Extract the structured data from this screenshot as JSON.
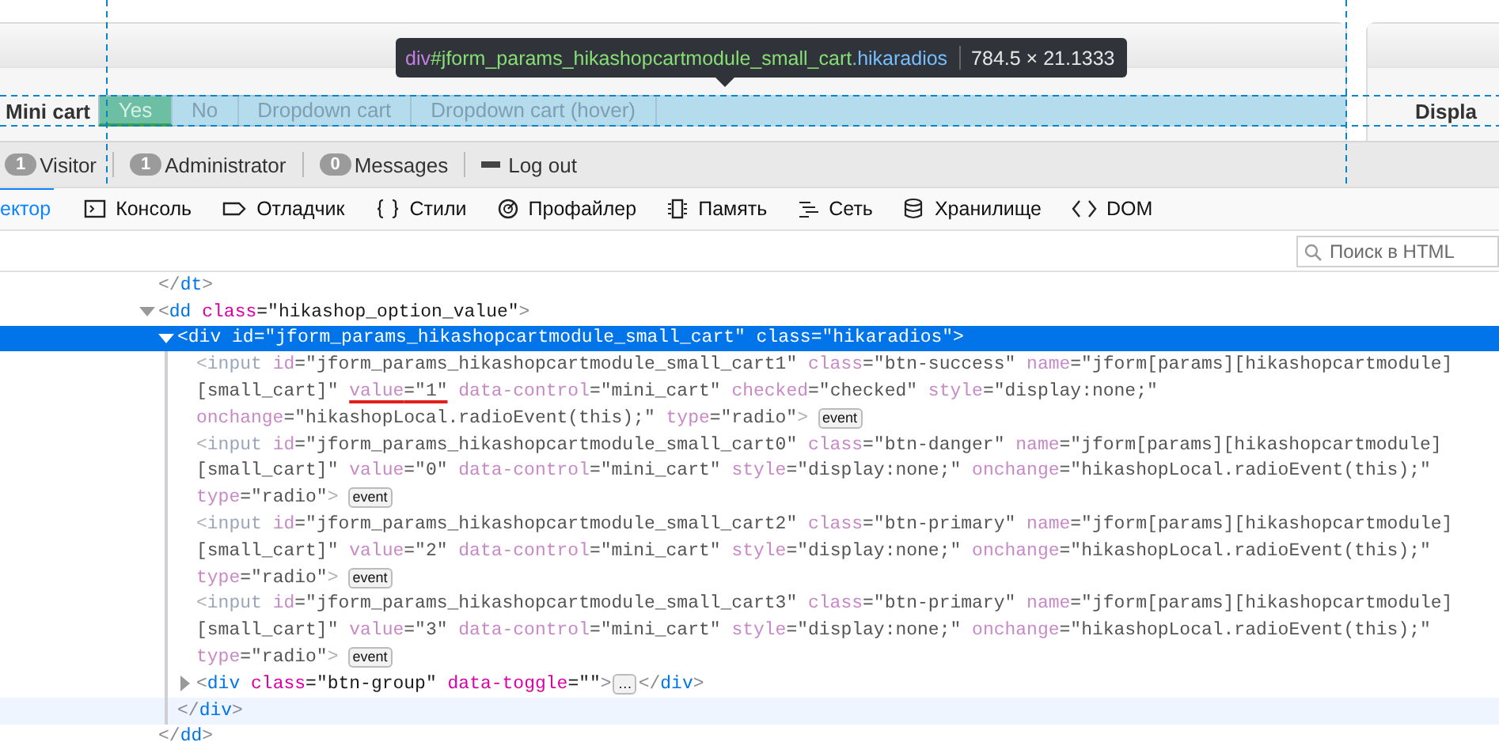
{
  "page": {
    "tooltip": {
      "tag": "div",
      "id": "#jform_params_hikashopcartmodule_small_cart",
      "class": ".hikaradios",
      "size": "784.5 × 21.1333"
    },
    "field_label": "Mini cart",
    "radios": [
      {
        "label": "Yes",
        "selected": true
      },
      {
        "label": "No",
        "selected": false
      },
      {
        "label": "Dropdown cart",
        "selected": false
      },
      {
        "label": "Dropdown cart (hover)",
        "selected": false
      }
    ],
    "next_label": "Displa"
  },
  "status_bar": [
    {
      "kind": "counter",
      "count": "1",
      "label": "Visitor"
    },
    {
      "kind": "counter",
      "count": "1",
      "label": "Administrator"
    },
    {
      "kind": "counter",
      "count": "0",
      "label": "Messages"
    },
    {
      "kind": "logout",
      "label": "Log out"
    }
  ],
  "devtools": {
    "tabs": [
      {
        "kind": "inspector",
        "label": "ектор",
        "selected": true
      },
      {
        "kind": "console",
        "label": "Консоль",
        "selected": false
      },
      {
        "kind": "debugger",
        "label": "Отладчик",
        "selected": false
      },
      {
        "kind": "styles",
        "label": "Стили",
        "selected": false
      },
      {
        "kind": "profiler",
        "label": "Профайлер",
        "selected": false
      },
      {
        "kind": "memory",
        "label": "Память",
        "selected": false
      },
      {
        "kind": "network",
        "label": "Сеть",
        "selected": false
      },
      {
        "kind": "storage",
        "label": "Хранилище",
        "selected": false
      },
      {
        "kind": "dom",
        "label": "DOM",
        "selected": false
      }
    ],
    "search": {
      "placeholder": "Поиск в HTML"
    },
    "tree": [
      {
        "selected": false,
        "dimmed": false,
        "lines": [
          [
            {
              "kind": "p",
              "t": "</"
            },
            {
              "kind": "tag",
              "t": "dt"
            },
            {
              "kind": "p",
              "t": ">"
            }
          ]
        ]
      },
      {
        "selected": false,
        "dimmed": false,
        "expanded": true,
        "lines": [
          [
            {
              "kind": "p",
              "t": "<"
            },
            {
              "kind": "tag",
              "t": "dd"
            },
            {
              "kind": "pair",
              "n": " class",
              "v": "=\"hikashop_option_value\""
            },
            {
              "kind": "p",
              "t": ">"
            }
          ]
        ],
        "children": [
          {
            "selected": true,
            "dimmed": false,
            "expanded": true,
            "lines": [
              [
                {
                  "kind": "p",
                  "t": "<"
                },
                {
                  "kind": "tag",
                  "t": "div"
                },
                {
                  "kind": "pair",
                  "n": " id",
                  "v": "=\"jform_params_hikashopcartmodule_small_cart\""
                },
                {
                  "kind": "pair",
                  "n": " class",
                  "v": "=\"hikaradios\""
                },
                {
                  "kind": "p",
                  "t": ">"
                }
              ]
            ],
            "children": [
              {
                "selected": false,
                "dimmed": true,
                "lines": [
                  [
                    {
                      "kind": "p",
                      "t": "<"
                    },
                    {
                      "kind": "tag",
                      "t": "input"
                    },
                    {
                      "kind": "pair",
                      "n": " id",
                      "v": "=\"jform_params_hikashopcartmodule_small_cart1\""
                    },
                    {
                      "kind": "pair",
                      "n": " class",
                      "v": "=\"btn-success\""
                    },
                    {
                      "kind": "pair",
                      "n": " name",
                      "v": "=\"jform[params][hikashopcartmodule]"
                    }
                  ],
                  [
                    {
                      "kind": "v",
                      "t": "[small_cart]\" "
                    },
                    {
                      "kind": "pair",
                      "n": "value",
                      "v": "=\"1\"",
                      "annotated": true
                    },
                    {
                      "kind": "pair",
                      "n": " data-control",
                      "v": "=\"mini_cart\""
                    },
                    {
                      "kind": "pair",
                      "n": " checked",
                      "v": "=\"checked\""
                    },
                    {
                      "kind": "pair",
                      "n": " style",
                      "v": "=\"display:none;\""
                    }
                  ],
                  [
                    {
                      "kind": "pair",
                      "n": "onchange",
                      "v": "=\"hikashopLocal.radioEvent(this);\""
                    },
                    {
                      "kind": "pair",
                      "n": " type",
                      "v": "=\"radio\""
                    },
                    {
                      "kind": "p",
                      "t": ">"
                    },
                    {
                      "kind": "badge",
                      "t": "event"
                    }
                  ]
                ]
              },
              {
                "selected": false,
                "dimmed": true,
                "lines": [
                  [
                    {
                      "kind": "p",
                      "t": "<"
                    },
                    {
                      "kind": "tag",
                      "t": "input"
                    },
                    {
                      "kind": "pair",
                      "n": " id",
                      "v": "=\"jform_params_hikashopcartmodule_small_cart0\""
                    },
                    {
                      "kind": "pair",
                      "n": " class",
                      "v": "=\"btn-danger\""
                    },
                    {
                      "kind": "pair",
                      "n": " name",
                      "v": "=\"jform[params][hikashopcartmodule]"
                    }
                  ],
                  [
                    {
                      "kind": "v",
                      "t": "[small_cart]\""
                    },
                    {
                      "kind": "pair",
                      "n": " value",
                      "v": "=\"0\""
                    },
                    {
                      "kind": "pair",
                      "n": " data-control",
                      "v": "=\"mini_cart\""
                    },
                    {
                      "kind": "pair",
                      "n": " style",
                      "v": "=\"display:none;\""
                    },
                    {
                      "kind": "pair",
                      "n": " onchange",
                      "v": "=\"hikashopLocal.radioEvent(this);\""
                    }
                  ],
                  [
                    {
                      "kind": "pair",
                      "n": "type",
                      "v": "=\"radio\""
                    },
                    {
                      "kind": "p",
                      "t": ">"
                    },
                    {
                      "kind": "badge",
                      "t": "event"
                    }
                  ]
                ]
              },
              {
                "selected": false,
                "dimmed": true,
                "lines": [
                  [
                    {
                      "kind": "p",
                      "t": "<"
                    },
                    {
                      "kind": "tag",
                      "t": "input"
                    },
                    {
                      "kind": "pair",
                      "n": " id",
                      "v": "=\"jform_params_hikashopcartmodule_small_cart2\""
                    },
                    {
                      "kind": "pair",
                      "n": " class",
                      "v": "=\"btn-primary\""
                    },
                    {
                      "kind": "pair",
                      "n": " name",
                      "v": "=\"jform[params][hikashopcartmodule]"
                    }
                  ],
                  [
                    {
                      "kind": "v",
                      "t": "[small_cart]\""
                    },
                    {
                      "kind": "pair",
                      "n": " value",
                      "v": "=\"2\""
                    },
                    {
                      "kind": "pair",
                      "n": " data-control",
                      "v": "=\"mini_cart\""
                    },
                    {
                      "kind": "pair",
                      "n": " style",
                      "v": "=\"display:none;\""
                    },
                    {
                      "kind": "pair",
                      "n": " onchange",
                      "v": "=\"hikashopLocal.radioEvent(this);\""
                    }
                  ],
                  [
                    {
                      "kind": "pair",
                      "n": "type",
                      "v": "=\"radio\""
                    },
                    {
                      "kind": "p",
                      "t": ">"
                    },
                    {
                      "kind": "badge",
                      "t": "event"
                    }
                  ]
                ]
              },
              {
                "selected": false,
                "dimmed": true,
                "lines": [
                  [
                    {
                      "kind": "p",
                      "t": "<"
                    },
                    {
                      "kind": "tag",
                      "t": "input"
                    },
                    {
                      "kind": "pair",
                      "n": " id",
                      "v": "=\"jform_params_hikashopcartmodule_small_cart3\""
                    },
                    {
                      "kind": "pair",
                      "n": " class",
                      "v": "=\"btn-primary\""
                    },
                    {
                      "kind": "pair",
                      "n": " name",
                      "v": "=\"jform[params][hikashopcartmodule]"
                    }
                  ],
                  [
                    {
                      "kind": "v",
                      "t": "[small_cart]\""
                    },
                    {
                      "kind": "pair",
                      "n": " value",
                      "v": "=\"3\""
                    },
                    {
                      "kind": "pair",
                      "n": " data-control",
                      "v": "=\"mini_cart\""
                    },
                    {
                      "kind": "pair",
                      "n": " style",
                      "v": "=\"display:none;\""
                    },
                    {
                      "kind": "pair",
                      "n": " onchange",
                      "v": "=\"hikashopLocal.radioEvent(this);\""
                    }
                  ],
                  [
                    {
                      "kind": "pair",
                      "n": "type",
                      "v": "=\"radio\""
                    },
                    {
                      "kind": "p",
                      "t": ">"
                    },
                    {
                      "kind": "badge",
                      "t": "event"
                    }
                  ]
                ]
              },
              {
                "selected": false,
                "dimmed": false,
                "expanded": false,
                "lines": [
                  [
                    {
                      "kind": "p",
                      "t": "<"
                    },
                    {
                      "kind": "tag",
                      "t": "div"
                    },
                    {
                      "kind": "pair",
                      "n": " class",
                      "v": "=\"btn-group\""
                    },
                    {
                      "kind": "pair",
                      "n": " data-toggle",
                      "v": "=\"\""
                    },
                    {
                      "kind": "p",
                      "t": ">"
                    },
                    {
                      "kind": "more",
                      "t": "…"
                    },
                    {
                      "kind": "p",
                      "t": "</"
                    },
                    {
                      "kind": "tag",
                      "t": "div"
                    },
                    {
                      "kind": "p",
                      "t": ">"
                    }
                  ]
                ]
              }
            ],
            "close": {
              "hovered": true,
              "tokens": [
                {
                  "kind": "p",
                  "t": "</"
                },
                {
                  "kind": "tag",
                  "t": "div"
                },
                {
                  "kind": "p",
                  "t": ">"
                }
              ]
            }
          }
        ],
        "close": {
          "hovered": false,
          "tokens": [
            {
              "kind": "p",
              "t": "</"
            },
            {
              "kind": "tag",
              "t": "dd"
            },
            {
              "kind": "p",
              "t": ">"
            }
          ]
        }
      }
    ]
  }
}
